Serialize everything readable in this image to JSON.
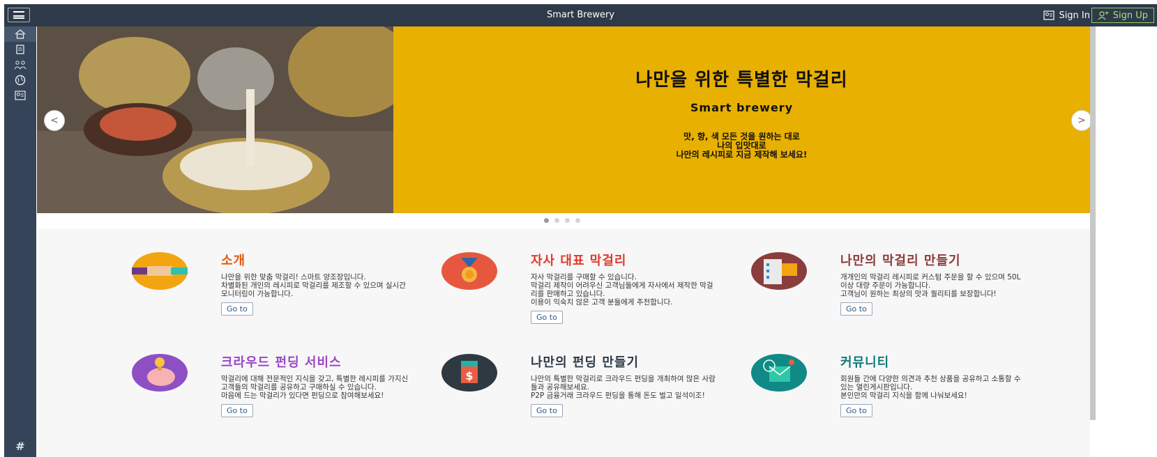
{
  "topbar": {
    "title": "Smart Brewery",
    "signin_label": "Sign In",
    "signup_label": "Sign Up"
  },
  "sidebar": {
    "items": [
      {
        "icon": "home-icon"
      },
      {
        "icon": "document-icon"
      },
      {
        "icon": "group-icon"
      },
      {
        "icon": "globe-icon"
      },
      {
        "icon": "user-card-icon"
      }
    ],
    "hash": "#"
  },
  "hero": {
    "title": "나만을 위한 특별한 막걸리",
    "subtitle": "Smart brewery",
    "line1": "맛, 향, 색 모든 것을 원하는 대로",
    "line2": "나의 입맛대로",
    "line3": "나만의 레시피로 지금 제작해 보세요!",
    "prev": "<",
    "next": ">"
  },
  "tiles": [
    {
      "title": "소개",
      "title_color": "#e05a0c",
      "text": "나만을 위한 맞춤 막걸리! 스마트 양조장입니다.\n차별화된 개인의 레시피로 막걸리를 제조할 수 있으며 실시간 모니터링이 가능합니다.",
      "button": "Go to",
      "icon": "handshake-icon"
    },
    {
      "title": "자사 대표 막걸리",
      "title_color": "#e03a2a",
      "text": "자사 막걸리를 구매할 수 있습니다.\n막걸리 제작이 어려우신 고객님들에게 자사에서 제작한 막걸리를 판매하고 있습니다.\n이용이 익숙치 않은 고객 분들에게 추천합니다.",
      "button": "Go to",
      "icon": "medal-icon"
    },
    {
      "title": "나만의 막걸리 만들기",
      "title_color": "#8e3a3a",
      "text": "개개인의 막걸리 레시피로 커스텀 주문을 할 수 있으며 50L 이상 대량 주문이 가능합니다.\n고객님이 원하는 최상의 맛과 퀄리티를 보장합니다!",
      "button": "Go to",
      "icon": "checklist-icon"
    },
    {
      "title": "크라우드 펀딩 서비스",
      "title_color": "#9a45c8",
      "text": "막걸리에 대해 전문적인 지식을 갖고, 특별한 레시피를 가지신 고객들의 막걸리를 공유하고 구매하실 수 있습니다.\n마음에 드는 막걸리가 있다면 펀딩으로 참여해보세요!",
      "button": "Go to",
      "icon": "piggy-bank-icon"
    },
    {
      "title": "나만의 펀딩 만들기",
      "title_color": "#2e3a49",
      "text": "나만의 특별한 막걸리로 크라우드 펀딩을 개최하여 많은 사람들과 공유해보세요.\nP2P 금융거래 크라우드 펀딩을 통해 돈도 벌고 일석이조!",
      "button": "Go to",
      "icon": "money-icon"
    },
    {
      "title": "커뮤니티",
      "title_color": "#0f7a7a",
      "text": "회원들 간에 다양한 의견과 추천 상품을 공유하고 소통할 수 있는 열린게시판입니다.\n본인만의 막걸리 지식을 함께 나눠보세요!",
      "button": "Go to",
      "icon": "globe-mail-icon"
    }
  ]
}
